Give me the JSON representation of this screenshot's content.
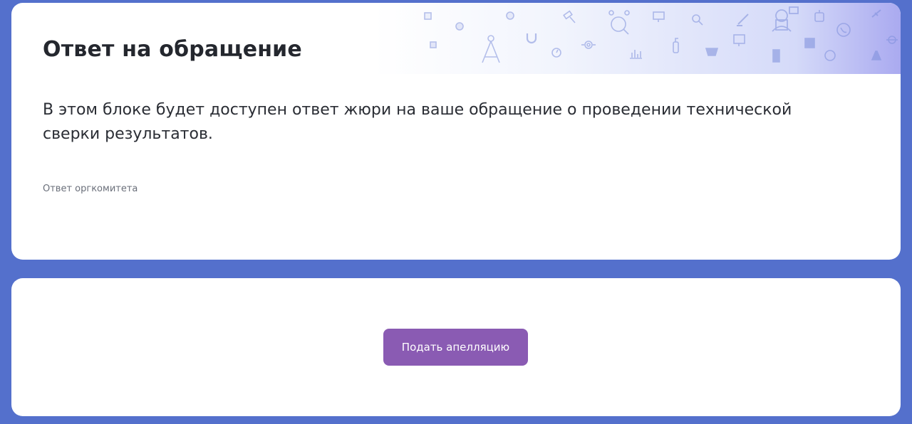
{
  "answer_card": {
    "title": "Ответ на обращение",
    "description": "В этом блоке будет доступен ответ жюри на ваше обращение о проведении технической сверки результатов.",
    "caption": "Ответ оргкомитета"
  },
  "appeal_card": {
    "button_label": "Подать апелляцию"
  },
  "decoration": {
    "icons": [
      "compass-icon",
      "magnet-icon",
      "stopwatch-icon",
      "gavel-icon",
      "molecule-icon",
      "chart-magnifier-icon",
      "monitor-icon",
      "microscope-icon",
      "fire-extinguisher-icon",
      "gem-icon",
      "scientist-icon",
      "code-icon",
      "robot-icon",
      "chip-icon",
      "scroll-icon",
      "phone-icon",
      "flask-icon",
      "planet-icon"
    ]
  },
  "colors": {
    "page_background": "#5470cc",
    "card_background": "#ffffff",
    "button_background": "#8a5bb3",
    "decor_icon": "#6a7fd8"
  }
}
